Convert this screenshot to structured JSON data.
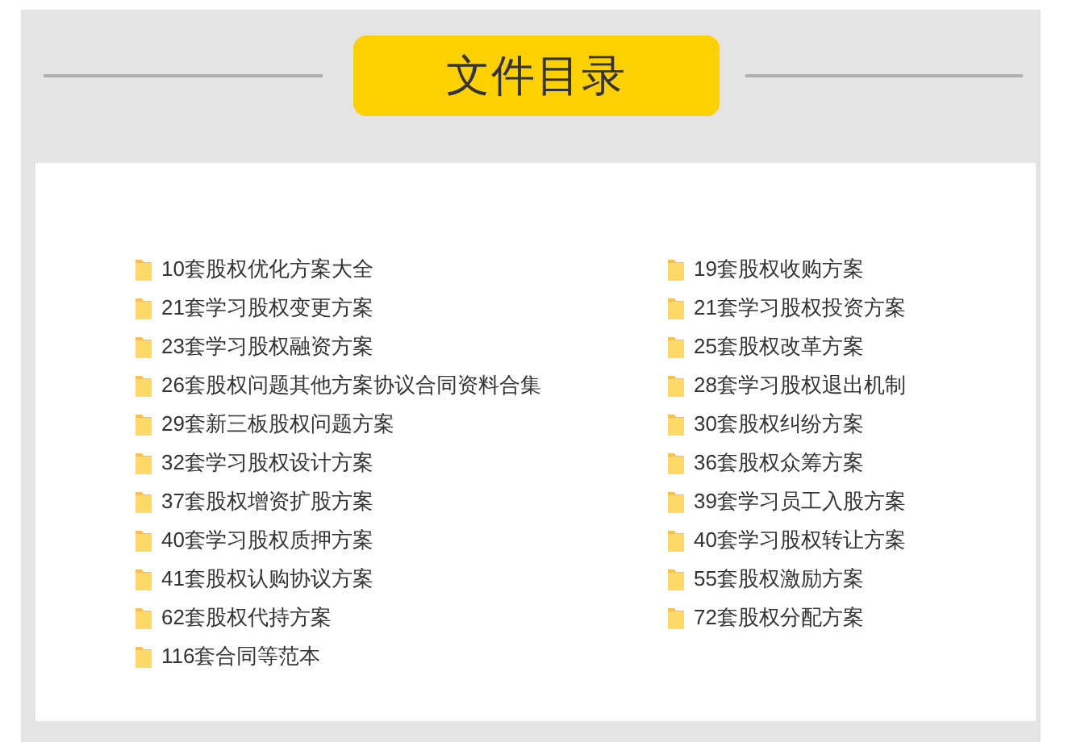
{
  "title": "文件目录",
  "columns": [
    {
      "items": [
        {
          "label": "10套股权优化方案大全"
        },
        {
          "label": "21套学习股权变更方案"
        },
        {
          "label": "23套学习股权融资方案"
        },
        {
          "label": "26套股权问题其他方案协议合同资料合集"
        },
        {
          "label": "29套新三板股权问题方案"
        },
        {
          "label": "32套学习股权设计方案"
        },
        {
          "label": "37套股权增资扩股方案"
        },
        {
          "label": "40套学习股权质押方案"
        },
        {
          "label": "41套股权认购协议方案"
        },
        {
          "label": "62套股权代持方案"
        },
        {
          "label": "116套合同等范本"
        }
      ]
    },
    {
      "items": [
        {
          "label": "19套股权收购方案"
        },
        {
          "label": "21套学习股权投资方案"
        },
        {
          "label": "25套股权改革方案"
        },
        {
          "label": "28套学习股权退出机制"
        },
        {
          "label": "30套股权纠纷方案"
        },
        {
          "label": "36套股权众筹方案"
        },
        {
          "label": "39套学习员工入股方案"
        },
        {
          "label": "40套学习股权转让方案"
        },
        {
          "label": "55套股权激励方案"
        },
        {
          "label": "72套股权分配方案"
        }
      ]
    }
  ]
}
